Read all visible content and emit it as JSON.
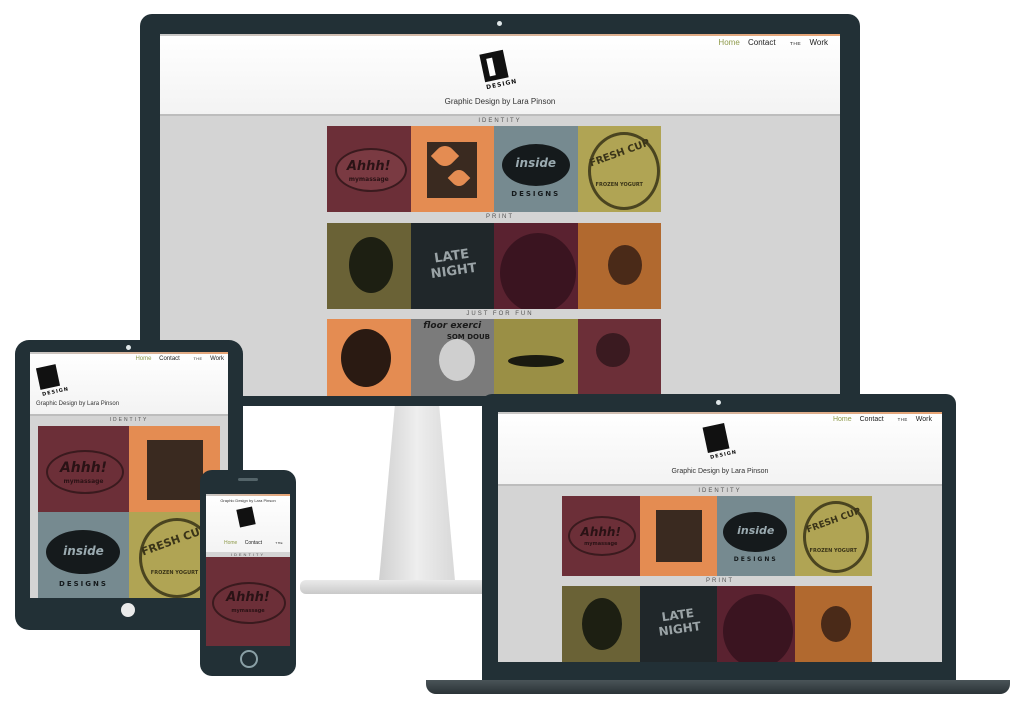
{
  "site": {
    "nav": {
      "home": "Home",
      "contact": "Contact",
      "the": "THE",
      "work": "Work"
    },
    "logo_text": "DESIGN",
    "tagline": "Graphic Design by Lara Pinson",
    "sections": [
      "IDENTITY",
      "PRINT",
      "JUST FOR FUN"
    ],
    "identity_tiles": [
      {
        "id": "ahhh",
        "text": "Ahhh!",
        "sub": "mymassage"
      },
      {
        "id": "flower",
        "text": ""
      },
      {
        "id": "inside",
        "text": "inside",
        "sub": "DESIGNS"
      },
      {
        "id": "freshcup",
        "text": "FRESH CUP",
        "sub": "FROZEN YOGURT"
      }
    ],
    "print_tiles": [
      {
        "id": "portrait",
        "text": ""
      },
      {
        "id": "latenight",
        "text": "LATE NIGHT"
      },
      {
        "id": "cup",
        "text": ""
      },
      {
        "id": "creature",
        "text": ""
      }
    ],
    "fun_tiles": [
      {
        "id": "dog",
        "text": ""
      },
      {
        "id": "floor",
        "text": "floor exerci",
        "sub": "SOM DOUB"
      },
      {
        "id": "mustache",
        "text": ""
      },
      {
        "id": "globe",
        "text": ""
      }
    ]
  },
  "colors": {
    "bezel": "#223036",
    "nav_home": "#8f9a4b",
    "wine": "#6c2f38",
    "orange": "#e48c52",
    "slate": "#768a90",
    "olive": "#b0a454"
  },
  "icons": [
    "camera-icon",
    "home-button-icon",
    "logo-icon"
  ]
}
